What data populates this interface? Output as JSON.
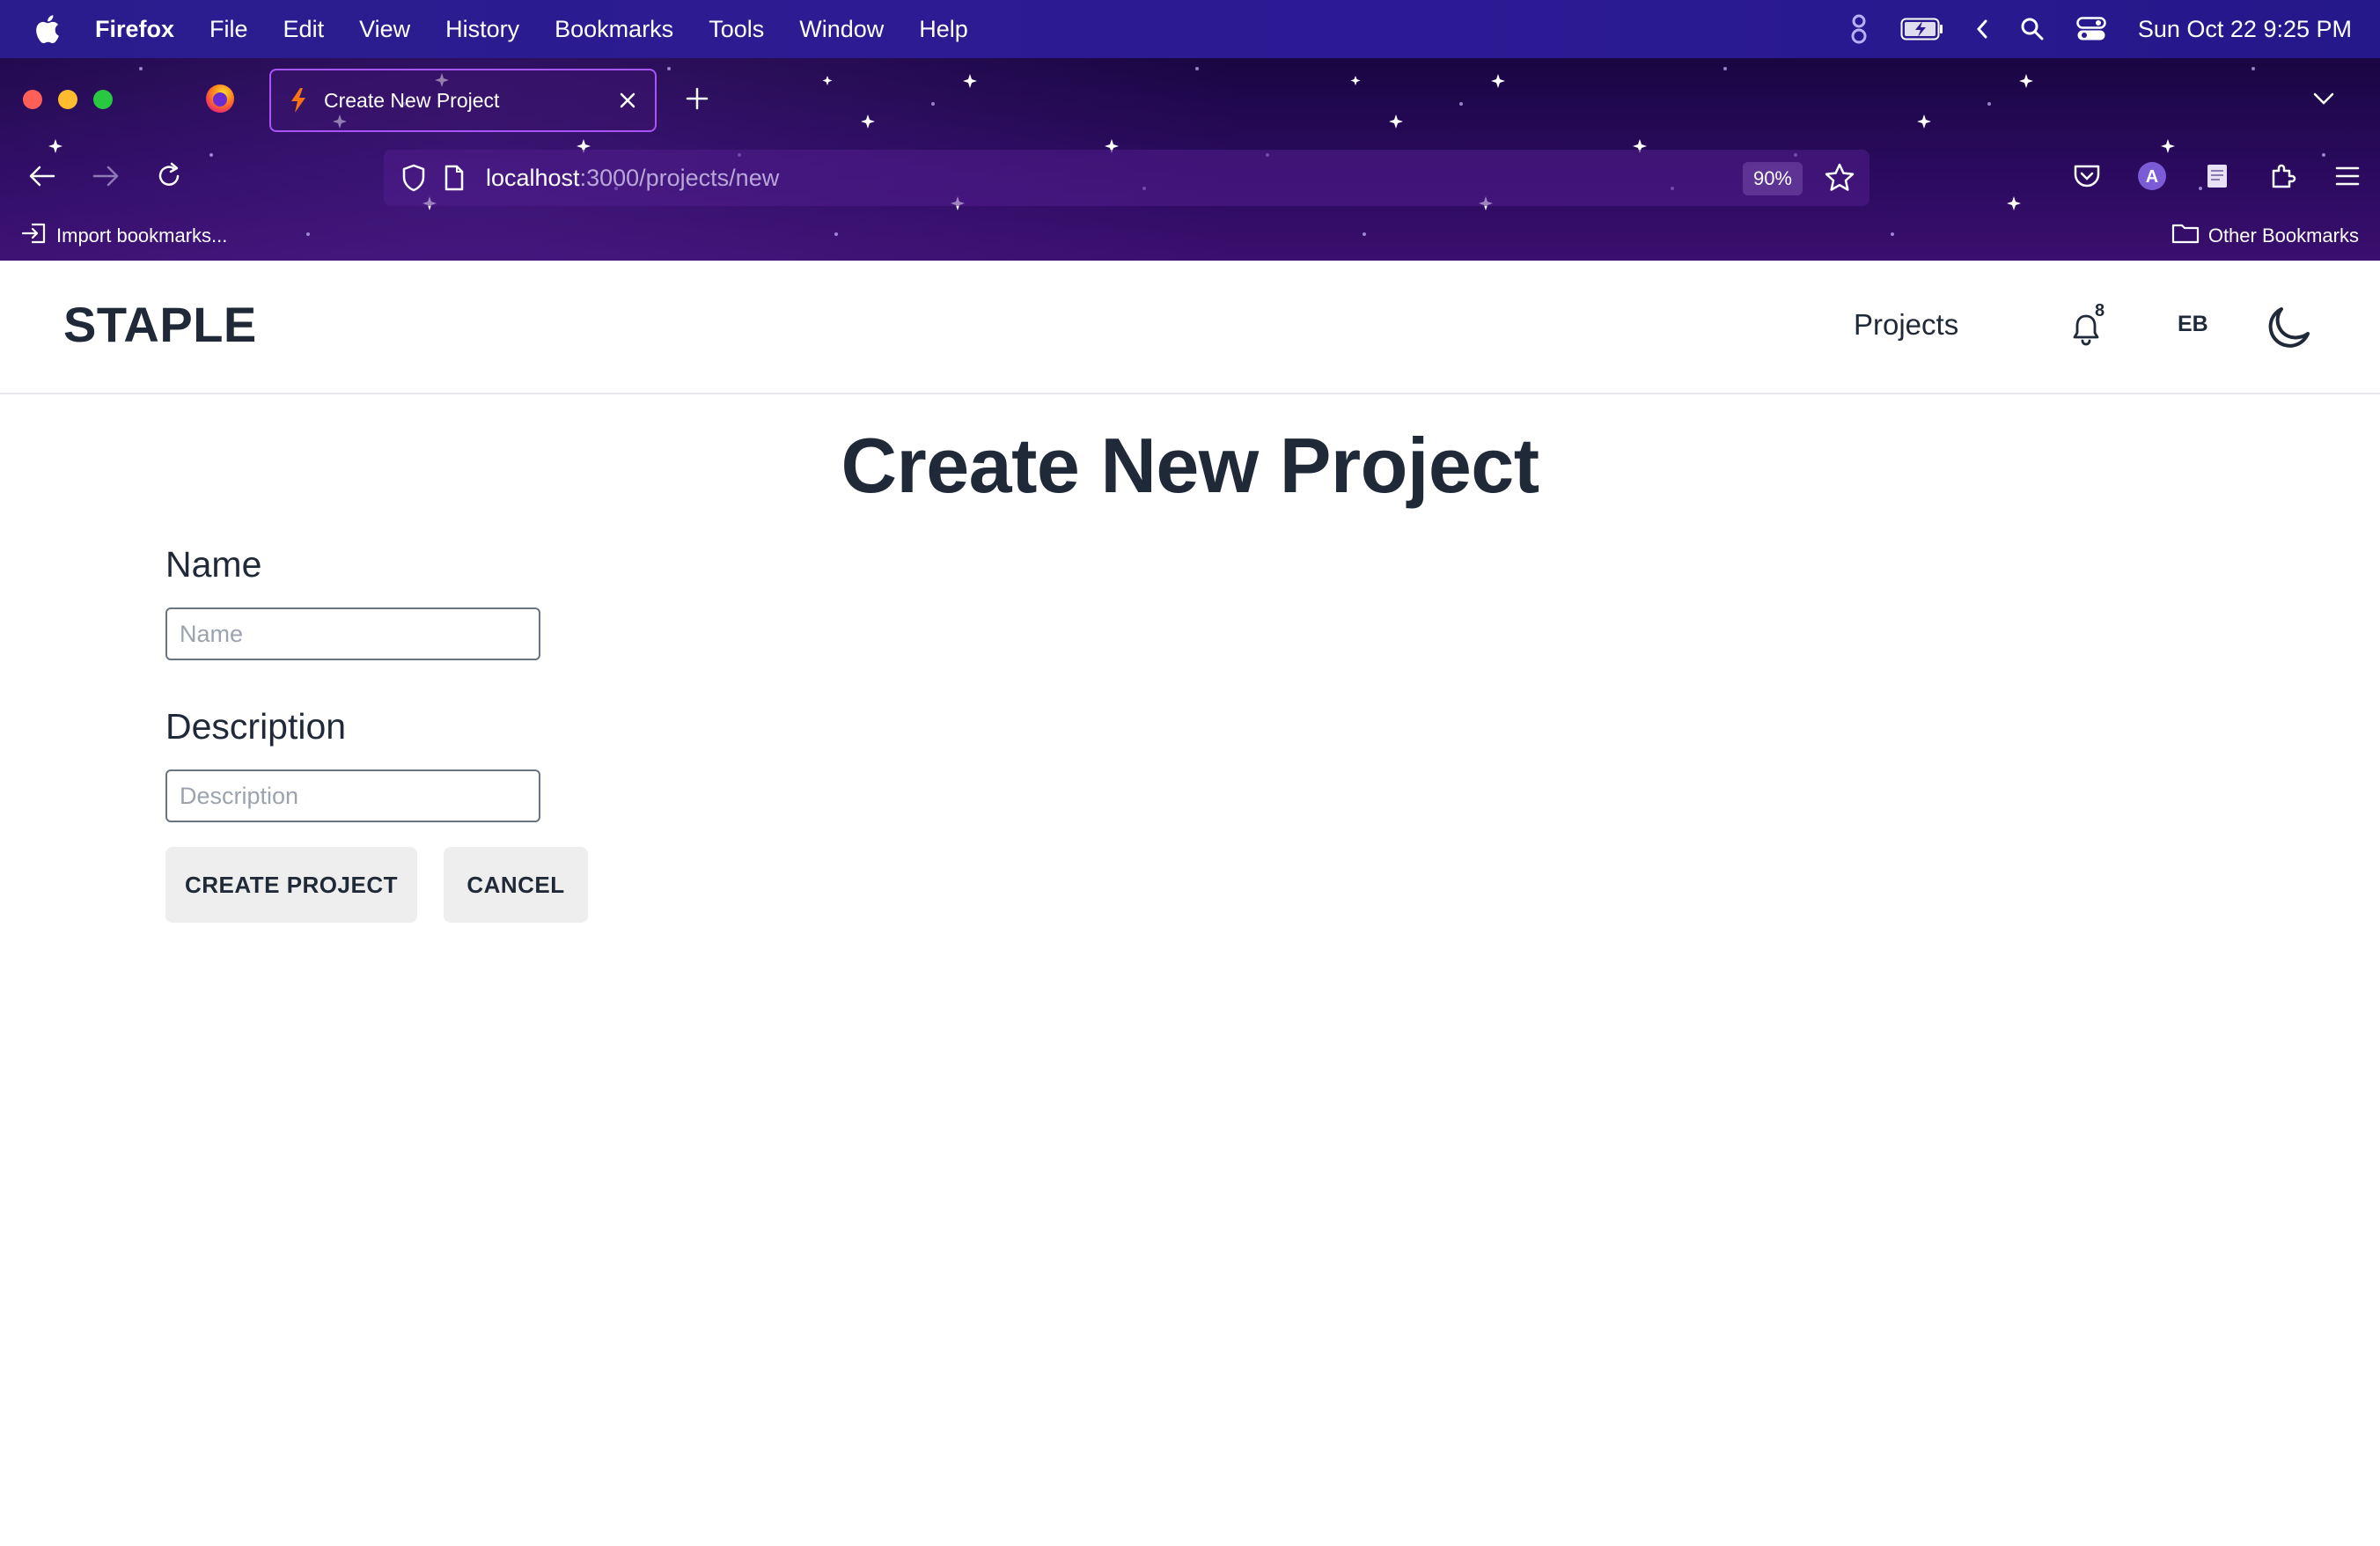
{
  "menubar": {
    "app_name": "Firefox",
    "items": [
      "File",
      "Edit",
      "View",
      "History",
      "Bookmarks",
      "Tools",
      "Window",
      "Help"
    ],
    "clock": "Sun Oct 22  9:25 PM"
  },
  "browser": {
    "tab_title": "Create New Project",
    "url_host": "localhost",
    "url_path": ":3000/projects/new",
    "zoom": "90%",
    "import_bookmarks": "Import bookmarks...",
    "other_bookmarks": "Other Bookmarks",
    "profile_initial": "A",
    "colors": {
      "tab_border": "#a855f7",
      "chrome_bg": "#2a0a5e",
      "menubar_bg": "#2c1a94"
    }
  },
  "site": {
    "logo": "STAPLE",
    "nav_projects": "Projects",
    "notification_count": "8",
    "user_initials": "EB"
  },
  "form": {
    "title": "Create New Project",
    "name_label": "Name",
    "name_placeholder": "Name",
    "name_value": "",
    "description_label": "Description",
    "description_placeholder": "Description",
    "description_value": "",
    "submit_label": "CREATE PROJECT",
    "cancel_label": "CANCEL"
  },
  "icons": {
    "menubar": [
      "apple-icon"
    ],
    "status": [
      "grammarly-icon",
      "battery-charging-icon",
      "chevron-left-icon",
      "spotlight-search-icon",
      "control-center-icon"
    ],
    "nav": [
      "back-arrow-icon",
      "forward-arrow-icon",
      "reload-icon",
      "shield-icon",
      "page-icon",
      "star-icon"
    ],
    "toolbar": [
      "pocket-icon",
      "account-icon",
      "reader-icon",
      "extensions-icon",
      "hamburger-menu-icon"
    ],
    "site": [
      "bell-icon",
      "moon-icon"
    ]
  }
}
